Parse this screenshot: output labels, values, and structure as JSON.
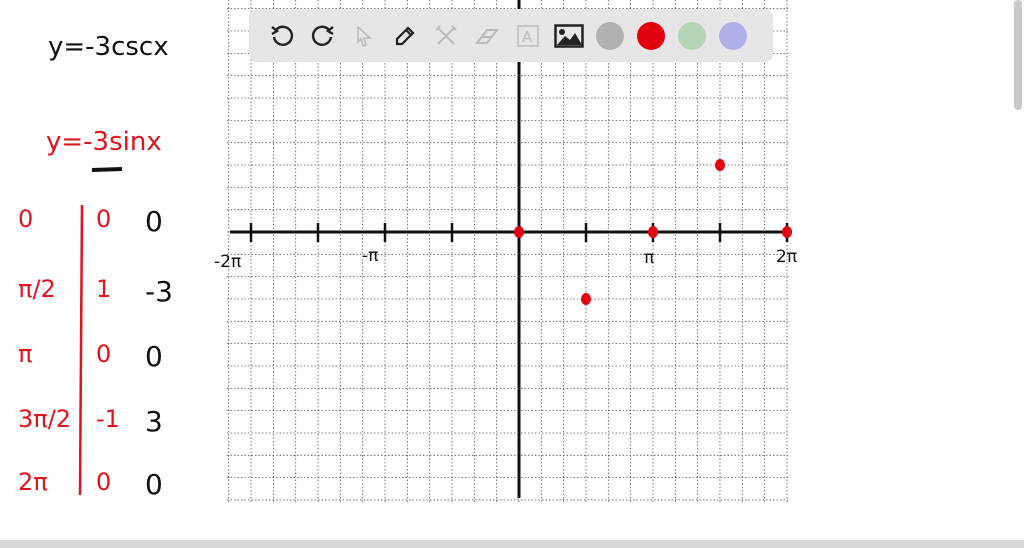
{
  "toolbar": {
    "tools": [
      "undo-icon",
      "redo-icon",
      "select-icon",
      "pen-icon",
      "tools-icon",
      "eraser-icon",
      "text-icon",
      "image-icon"
    ],
    "colors": [
      "#b0b0b0",
      "#e3000f",
      "#b5d3b5",
      "#b0b0e8"
    ],
    "selected_color": "#e3000f"
  },
  "notes": {
    "equation1": "y=-3cscx",
    "equation2": "y=-3sinx"
  },
  "table": {
    "rows": [
      {
        "x": "0",
        "sin": "0",
        "y": "0"
      },
      {
        "x": "π/2",
        "sin": "1",
        "y": "-3"
      },
      {
        "x": "π",
        "sin": "0",
        "y": "0"
      },
      {
        "x": "3π/2",
        "sin": "-1",
        "y": "3"
      },
      {
        "x": "2π",
        "sin": "0",
        "y": "0"
      }
    ]
  },
  "graph": {
    "tick_labels": [
      "-2π",
      "-π",
      "π",
      "2π"
    ],
    "points": [
      [
        0,
        0
      ],
      [
        1.5708,
        -3
      ],
      [
        3.1416,
        0
      ],
      [
        4.7124,
        3
      ],
      [
        6.2832,
        0
      ]
    ],
    "point_color": "#e3000f"
  }
}
